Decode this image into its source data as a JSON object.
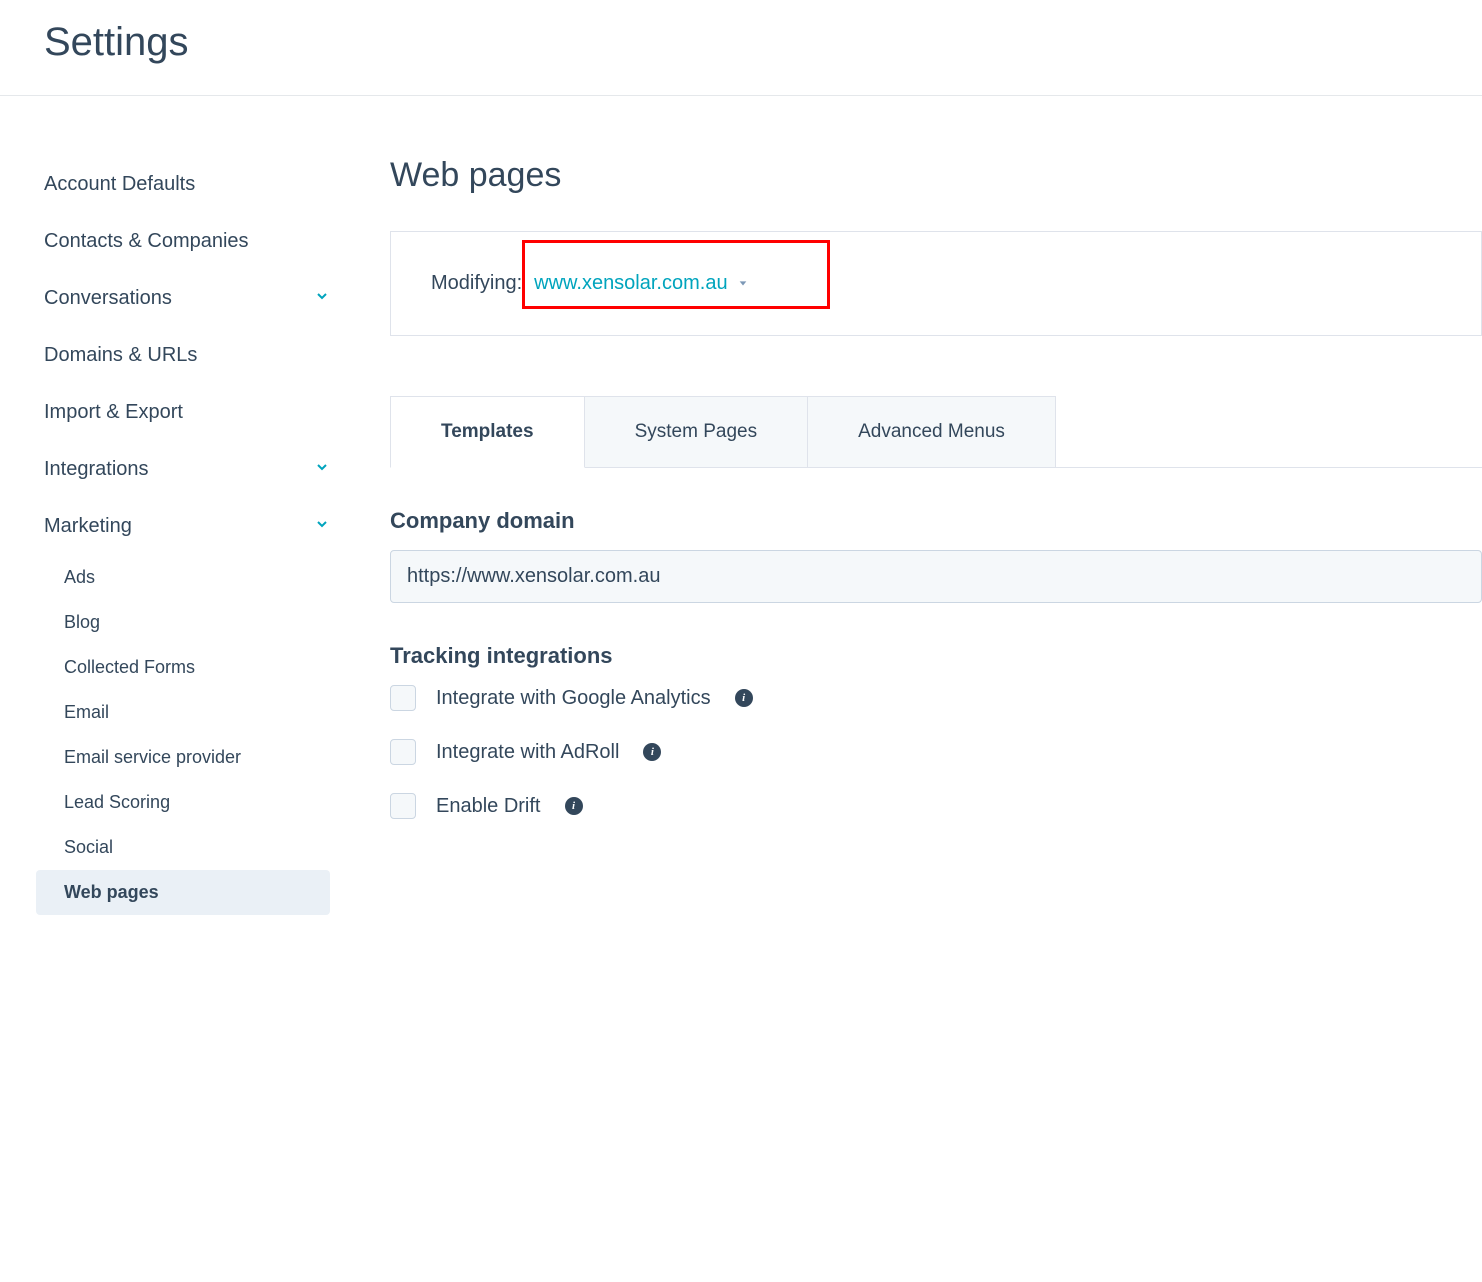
{
  "page_title": "Settings",
  "sidebar": {
    "items": [
      {
        "label": "Account Defaults",
        "expandable": false
      },
      {
        "label": "Contacts & Companies",
        "expandable": false
      },
      {
        "label": "Conversations",
        "expandable": true
      },
      {
        "label": "Domains & URLs",
        "expandable": false
      },
      {
        "label": "Import & Export",
        "expandable": false
      },
      {
        "label": "Integrations",
        "expandable": true
      },
      {
        "label": "Marketing",
        "expandable": true
      }
    ],
    "marketing_sub_items": [
      {
        "label": "Ads"
      },
      {
        "label": "Blog"
      },
      {
        "label": "Collected Forms"
      },
      {
        "label": "Email"
      },
      {
        "label": "Email service provider"
      },
      {
        "label": "Lead Scoring"
      },
      {
        "label": "Social"
      },
      {
        "label": "Web pages",
        "active": true
      }
    ]
  },
  "main": {
    "title": "Web pages",
    "modifying_label": "Modifying:",
    "domain_value": "www.xensolar.com.au",
    "tabs": [
      {
        "label": "Templates",
        "active": true
      },
      {
        "label": "System Pages",
        "active": false
      },
      {
        "label": "Advanced Menus",
        "active": false
      }
    ],
    "company_domain_heading": "Company domain",
    "company_domain_value": "https://www.xensolar.com.au",
    "tracking_heading": "Tracking integrations",
    "tracking_options": [
      {
        "label": "Integrate with Google Analytics"
      },
      {
        "label": "Integrate with AdRoll"
      },
      {
        "label": "Enable Drift"
      }
    ]
  }
}
